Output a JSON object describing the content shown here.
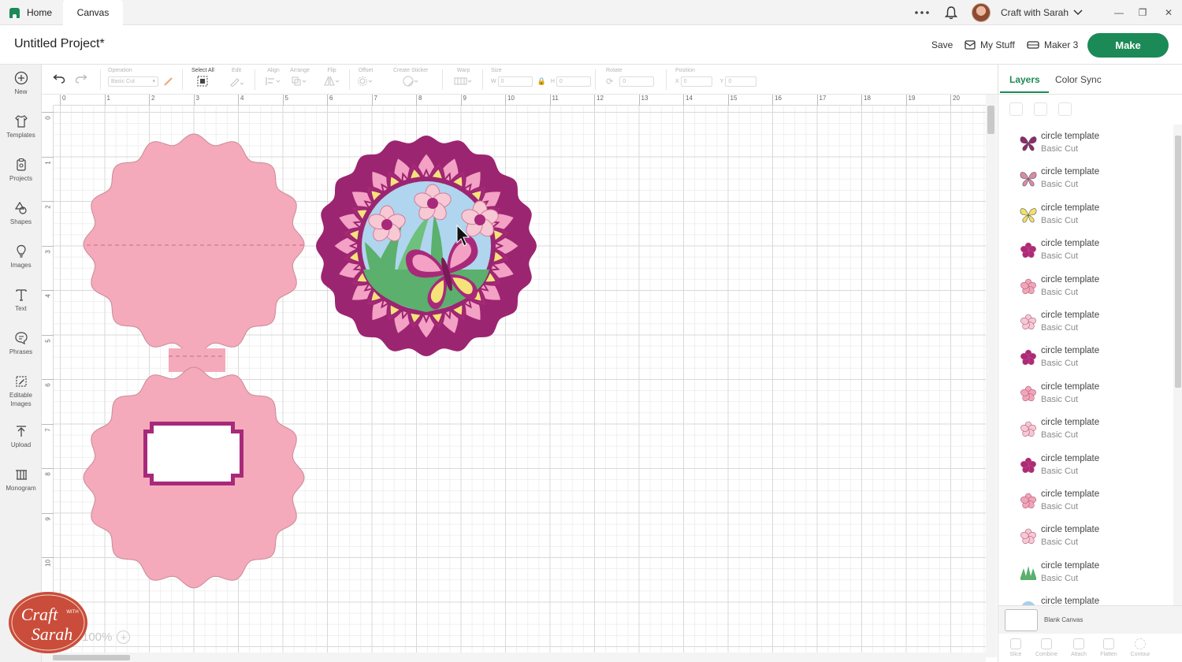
{
  "titlebar": {
    "home_tab": "Home",
    "canvas_tab": "Canvas",
    "user_name": "Craft with Sarah"
  },
  "header": {
    "project_title": "Untitled Project*",
    "save": "Save",
    "my_stuff": "My Stuff",
    "machine": "Maker 3",
    "make": "Make"
  },
  "leftnav": [
    {
      "label": "New",
      "icon": "plus-circle-icon"
    },
    {
      "label": "Templates",
      "icon": "shirt-icon"
    },
    {
      "label": "Projects",
      "icon": "clipboard-icon"
    },
    {
      "label": "Shapes",
      "icon": "shapes-icon"
    },
    {
      "label": "Images",
      "icon": "lightbulb-icon"
    },
    {
      "label": "Text",
      "icon": "text-icon"
    },
    {
      "label": "Phrases",
      "icon": "speech-bubble-icon"
    },
    {
      "label": "Editable Images",
      "icon": "edit-image-icon"
    },
    {
      "label": "Upload",
      "icon": "upload-icon"
    },
    {
      "label": "Monogram",
      "icon": "monogram-icon"
    }
  ],
  "toolbar": {
    "operation_label": "Operation",
    "operation_value": "Basic Cut",
    "select_all": "Select All",
    "edit": "Edit",
    "align": "Align",
    "arrange": "Arrange",
    "flip": "Flip",
    "offset": "Offset",
    "create_sticker": "Create Sticker",
    "warp": "Warp",
    "size": "Size",
    "size_w": "W",
    "size_h": "H",
    "rotate": "Rotate",
    "position": "Position",
    "pos_x": "X",
    "pos_y": "Y",
    "zero": "0"
  },
  "ruler": {
    "h": [
      "0",
      "1",
      "2",
      "3",
      "4",
      "5",
      "6",
      "7",
      "8",
      "9",
      "10",
      "11",
      "12",
      "13",
      "14",
      "15",
      "16",
      "17",
      "18",
      "19",
      "20"
    ],
    "v": [
      "0",
      "1",
      "2",
      "3",
      "4",
      "5",
      "6",
      "7",
      "8",
      "9",
      "10"
    ]
  },
  "canvas": {
    "zoom": "100%"
  },
  "logo": {
    "text_line1": "Craft",
    "text_with": "WITH",
    "text_line2": "Sarah"
  },
  "right_panel": {
    "tabs": [
      "Layers",
      "Color Sync"
    ],
    "layers": [
      {
        "name": "circle template",
        "op": "Basic Cut",
        "thumb": "butterfly-dark-icon",
        "color": "#8e2a6e"
      },
      {
        "name": "circle template",
        "op": "Basic Cut",
        "thumb": "butterfly-pink-icon",
        "color": "#d98aa8"
      },
      {
        "name": "circle template",
        "op": "Basic Cut",
        "thumb": "butterfly-yellow-icon",
        "color": "#f0e06a"
      },
      {
        "name": "circle template",
        "op": "Basic Cut",
        "thumb": "flower-magenta-icon",
        "color": "#b0287a"
      },
      {
        "name": "circle template",
        "op": "Basic Cut",
        "thumb": "flower-pink-icon",
        "color": "#f1a6b8"
      },
      {
        "name": "circle template",
        "op": "Basic Cut",
        "thumb": "flower-light-icon",
        "color": "#f6c9d4"
      },
      {
        "name": "circle template",
        "op": "Basic Cut",
        "thumb": "flower-magenta-icon",
        "color": "#b0287a"
      },
      {
        "name": "circle template",
        "op": "Basic Cut",
        "thumb": "flower-pink-icon",
        "color": "#f1a6b8"
      },
      {
        "name": "circle template",
        "op": "Basic Cut",
        "thumb": "flower-light-icon",
        "color": "#f6c9d4"
      },
      {
        "name": "circle template",
        "op": "Basic Cut",
        "thumb": "flower-magenta-icon",
        "color": "#b0287a"
      },
      {
        "name": "circle template",
        "op": "Basic Cut",
        "thumb": "flower-pink-icon",
        "color": "#f1a6b8"
      },
      {
        "name": "circle template",
        "op": "Basic Cut",
        "thumb": "flower-light-icon",
        "color": "#f6c9d4"
      },
      {
        "name": "circle template",
        "op": "Basic Cut",
        "thumb": "leaves-green-icon",
        "color": "#5ab06c"
      },
      {
        "name": "circle template",
        "op": "",
        "thumb": "circle-blue-icon",
        "color": "#a9cfe9"
      }
    ],
    "blank_canvas": "Blank Canvas",
    "bottom_tools": [
      "Slice",
      "Combine",
      "Attach",
      "Flatten",
      "Contour"
    ]
  },
  "colors": {
    "accent": "#1b8a57",
    "card_pink": "#f4aabb",
    "mandala_magenta": "#a8297a"
  }
}
